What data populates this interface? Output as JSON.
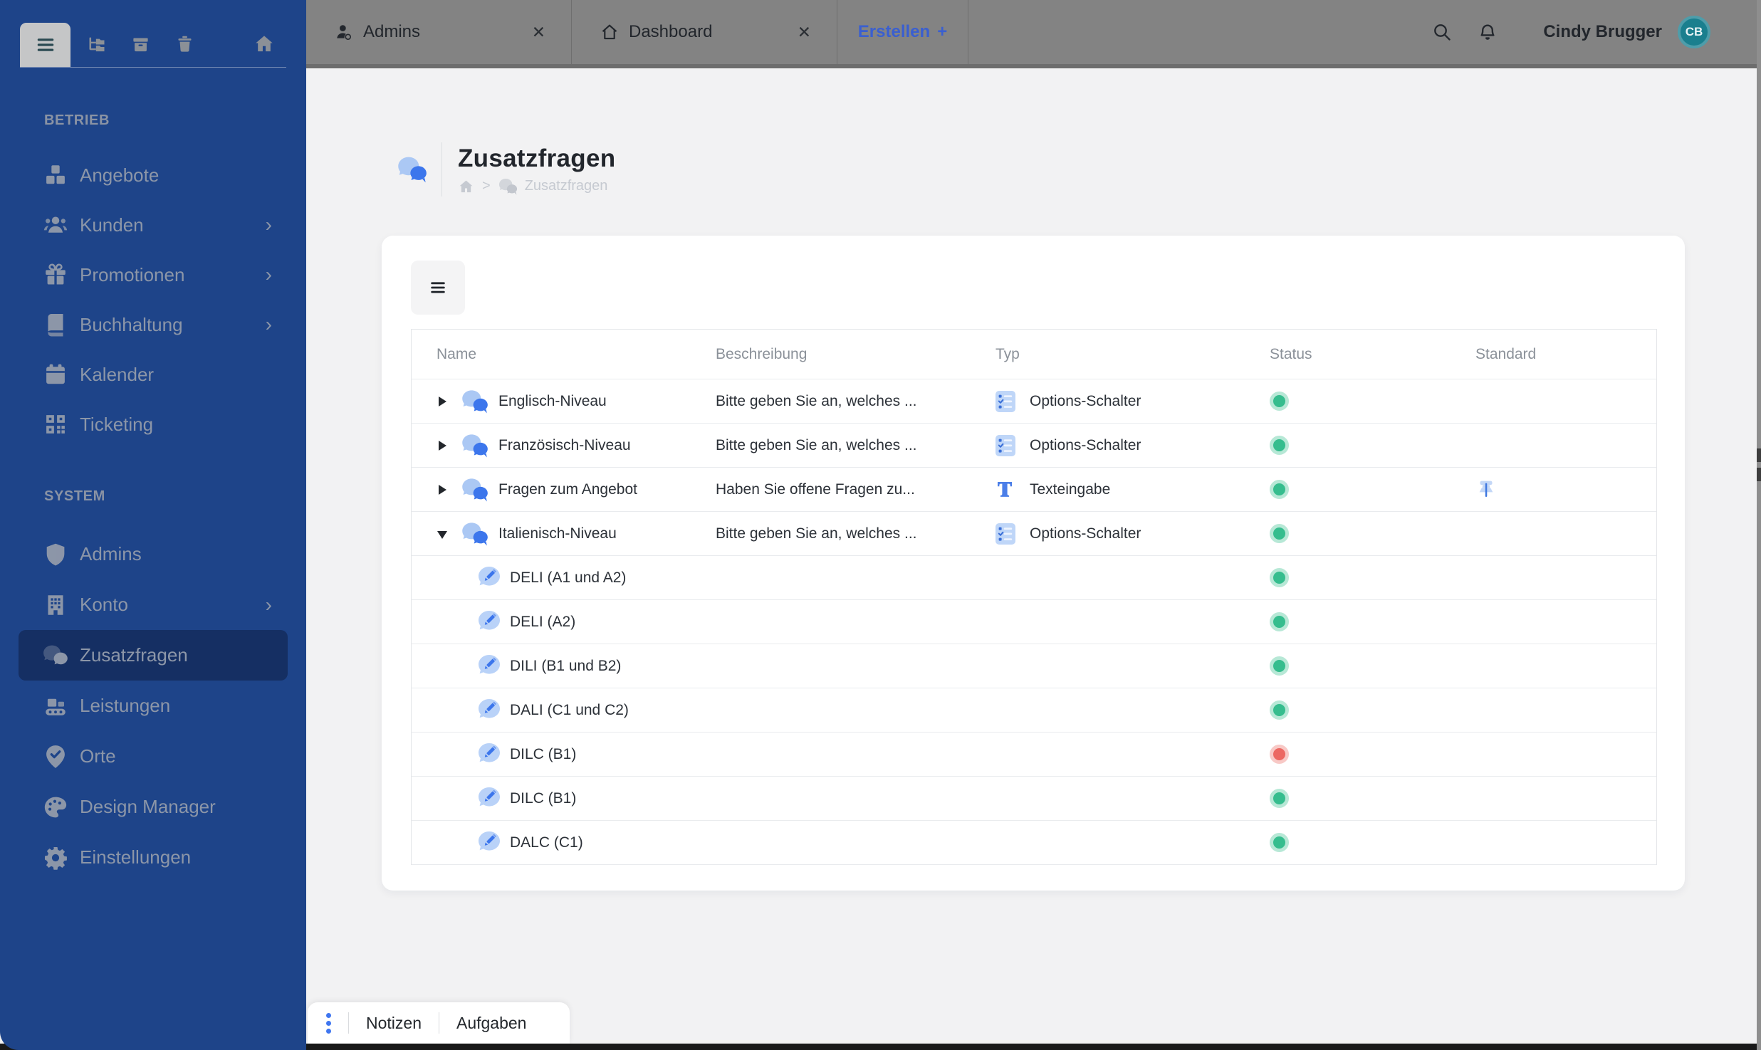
{
  "topbar": {
    "close_glyph": "✕",
    "tabs": [
      {
        "label": "Admins",
        "icon": "user"
      },
      {
        "label": "Dashboard",
        "icon": "home-outline"
      }
    ],
    "create_tab": {
      "label": "Erstellen",
      "plus": "+"
    },
    "user": {
      "name": "Cindy Brugger",
      "initials": "CB"
    }
  },
  "sidebar": {
    "sections": [
      {
        "title": "BETRIEB",
        "items": [
          {
            "label": "Angebote",
            "icon": "cubes"
          },
          {
            "label": "Kunden",
            "icon": "users",
            "chevron": true
          },
          {
            "label": "Promotionen",
            "icon": "gift",
            "chevron": true
          },
          {
            "label": "Buchhaltung",
            "icon": "book",
            "chevron": true
          },
          {
            "label": "Kalender",
            "icon": "calendar"
          },
          {
            "label": "Ticketing",
            "icon": "qr"
          }
        ]
      },
      {
        "title": "SYSTEM",
        "items": [
          {
            "label": "Admins",
            "icon": "shield"
          },
          {
            "label": "Konto",
            "icon": "building",
            "chevron": true
          },
          {
            "label": "Zusatzfragen",
            "icon": "chat",
            "active": true
          },
          {
            "label": "Leistungen",
            "icon": "services"
          },
          {
            "label": "Orte",
            "icon": "location"
          },
          {
            "label": "Design Manager",
            "icon": "palette"
          },
          {
            "label": "Einstellungen",
            "icon": "gear"
          }
        ]
      }
    ]
  },
  "page": {
    "title": "Zusatzfragen",
    "breadcrumb": {
      "separator": ">",
      "current": "Zusatzfragen"
    }
  },
  "table": {
    "headers": [
      "Name",
      "Beschreibung",
      "Typ",
      "Status",
      "Standard"
    ],
    "rows": [
      {
        "kind": "parent",
        "expanded": false,
        "name": "Englisch-Niveau",
        "description": "Bitte geben Sie an, welches ...",
        "type": "Options-Schalter",
        "type_icon": "options",
        "status": "active",
        "standard": false
      },
      {
        "kind": "parent",
        "expanded": false,
        "name": "Französisch-Niveau",
        "description": "Bitte geben Sie an, welches ...",
        "type": "Options-Schalter",
        "type_icon": "options",
        "status": "active",
        "standard": false
      },
      {
        "kind": "parent",
        "expanded": false,
        "name": "Fragen zum Angebot",
        "description": "Haben Sie offene Fragen zu...",
        "type": "Texteingabe",
        "type_icon": "text",
        "status": "active",
        "standard": true
      },
      {
        "kind": "parent",
        "expanded": true,
        "name": "Italienisch-Niveau",
        "description": "Bitte geben Sie an, welches ...",
        "type": "Options-Schalter",
        "type_icon": "options",
        "status": "active",
        "standard": false
      },
      {
        "kind": "child",
        "name": "DELI (A1 und A2)",
        "status": "active"
      },
      {
        "kind": "child",
        "name": "DELI (A2)",
        "status": "active"
      },
      {
        "kind": "child",
        "name": "DILI (B1 und B2)",
        "status": "active"
      },
      {
        "kind": "child",
        "name": "DALI (C1 und C2)",
        "status": "active"
      },
      {
        "kind": "child",
        "name": "DILC (B1)",
        "status": "inactive"
      },
      {
        "kind": "child",
        "name": "DILC (B1)",
        "status": "active"
      },
      {
        "kind": "child",
        "name": "DALC (C1)",
        "status": "active"
      }
    ]
  },
  "bottombar": {
    "tabs": [
      "Notizen",
      "Aufgaben"
    ]
  },
  "colors": {
    "sidebar_bg": "#1e4489",
    "sidebar_active_bg": "#152f63",
    "topbar_bg": "#838383",
    "accent_blue": "#3c76ec",
    "create_link_blue": "#3a5fd0",
    "status_active": "#36bd8e",
    "status_inactive": "#ec6862",
    "avatar_teal": "#1a7f8e"
  }
}
